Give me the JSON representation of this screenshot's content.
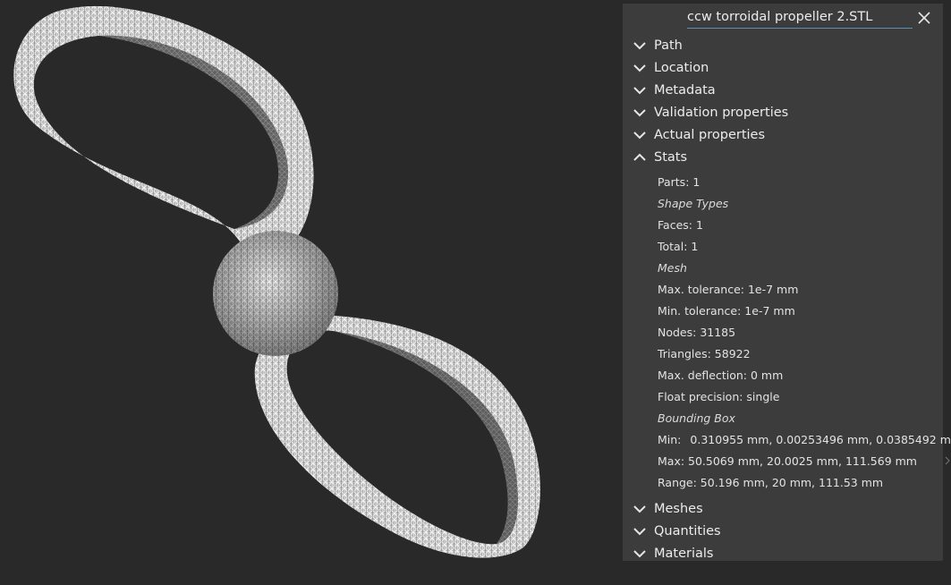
{
  "panel": {
    "title": "ccw torroidal propeller 2.STL",
    "sections_top": [
      {
        "label": "Path",
        "expanded": false
      },
      {
        "label": "Location",
        "expanded": false
      },
      {
        "label": "Metadata",
        "expanded": false
      },
      {
        "label": "Validation properties",
        "expanded": false
      },
      {
        "label": "Actual properties",
        "expanded": false
      },
      {
        "label": "Stats",
        "expanded": true
      }
    ],
    "stats": {
      "parts": "Parts: 1",
      "shape_types_heading": "Shape Types",
      "faces": "Faces: 1",
      "total": "Total: 1",
      "mesh_heading": "Mesh",
      "max_tolerance": "Max. tolerance: 1e-7 mm",
      "min_tolerance": "Min. tolerance: 1e-7 mm",
      "nodes": "Nodes: 31185",
      "triangles": "Triangles: 58922",
      "max_deflection": "Max. deflection: 0 mm",
      "float_precision": "Float precision: single",
      "bounding_box_heading": "Bounding Box",
      "min_label": "Min:",
      "min_value": "0.310955 mm, 0.00253496 mm, 0.0385492 mm",
      "max": "Max: 50.5069 mm, 20.0025 mm, 111.569 mm",
      "range": "Range: 50.196 mm, 20 mm, 111.53 mm"
    },
    "sections_bottom": [
      {
        "label": "Meshes",
        "expanded": false
      },
      {
        "label": "Quantities",
        "expanded": false
      },
      {
        "label": "Materials",
        "expanded": false
      }
    ]
  },
  "colors": {
    "background": "#292929",
    "panel": "#3c3c3c",
    "text": "#ececec",
    "accent_underline": "#5b8fb0",
    "mesh": "#c8c8c8"
  },
  "icons": {
    "close": "close-icon",
    "collapsed": "chevron-down-icon",
    "expanded": "chevron-up-icon"
  }
}
